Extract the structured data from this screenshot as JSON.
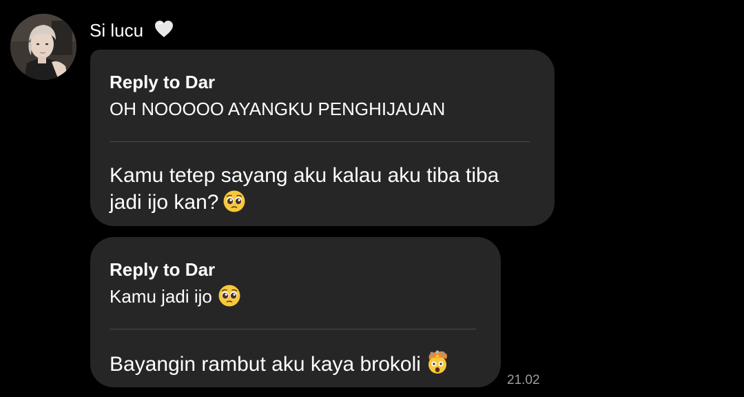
{
  "chat": {
    "sender_name": "Si lucu",
    "name_icon": "white-heart-icon",
    "messages": [
      {
        "reply_label": "Reply to Dar",
        "quoted_text": "OH NOOOOO AYANGKU PENGHIJAUAN",
        "text_line1": "Kamu tetep sayang aku kalau aku tiba tiba",
        "text_line2": "jadi ijo kan?",
        "text_emoji": "pleading-face-icon"
      },
      {
        "reply_label": "Reply to Dar",
        "quoted_text": "Kamu jadi ijo",
        "quoted_emoji": "pleading-face-icon",
        "text": "Bayangin rambut aku kaya brokoli",
        "text_emoji": "exploding-head-icon",
        "timestamp": "21.02"
      }
    ]
  },
  "colors": {
    "background": "#000000",
    "bubble": "#262626",
    "text": "#ffffff",
    "timestamp": "#9e9e9e",
    "divider": "#4a4a4a"
  }
}
